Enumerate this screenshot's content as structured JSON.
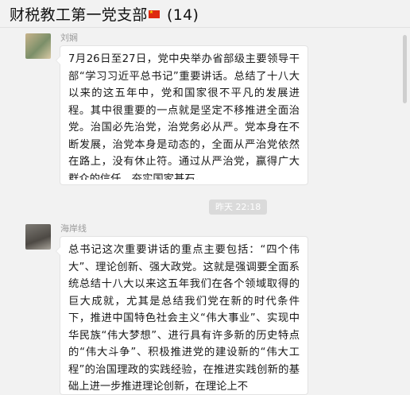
{
  "header": {
    "group_name": "财税教工第一党支部",
    "member_count": "(14)"
  },
  "messages": [
    {
      "sender": "刘娴",
      "text": "7月26日至27日，党中央举办省部级主要领导干部“学习习近平总书记”重要讲话。总结了十八大以来的这五年中，党和国家很不平凡的发展进程。其中很重要的一点就是坚定不移推进全面治党。治国必先治党，治党务必从严。党本身在不断发展，治党本身是动态的，全面从严治党依然在路上，没有休止符。通过从严治党，赢得广大群众的信任，夯实国家基石。"
    },
    {
      "sender": "海岸线",
      "text": "总书记这次重要讲话的重点主要包括：“四个伟大”、理论创新、强大政党。这就是强调要全面系统总结十八大以来这五年我们在各个领域取得的巨大成就，尤其是总结我们党在新的时代条件下，推进中国特色社会主义“伟大事业”、实现中华民族“伟大梦想”、进行具有许多新的历史特点的“伟大斗争”、积极推进党的建设新的“伟大工程”的治国理政的实践经验，在推进实践创新的基础上进一步推进理论创新，在理论上不"
    }
  ],
  "timestamp": "昨天 22:18",
  "icons": {
    "flag": "china-flag-icon",
    "avatar_1": "user-avatar",
    "avatar_2": "user-avatar"
  },
  "colors": {
    "background": "#f2f2f2",
    "bubble": "#ffffff",
    "flag": "#de2910"
  }
}
